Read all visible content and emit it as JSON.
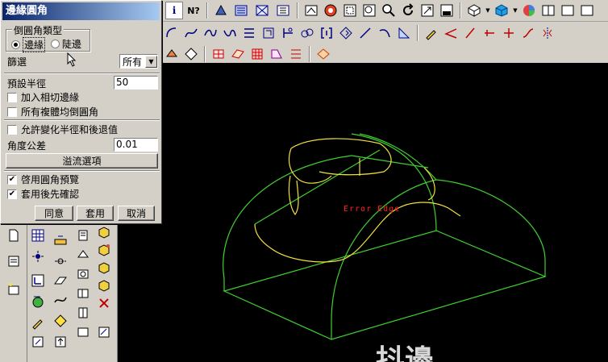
{
  "dialog": {
    "title": "邊緣圓角",
    "fillet_type_group": "倒圓角類型",
    "radio_edge": "邊緣",
    "radio_chain": "陡邊",
    "filter_label": "篩選",
    "filter_value": "所有",
    "default_radius_label": "預設半徑",
    "default_radius_value": "50",
    "add_tangent_edges": "加入相切邊緣",
    "fillet_all_solids": "所有複體均倒圓角",
    "allow_variable_radius": "允許變化半徑和後退值",
    "angle_tolerance_label": "角度公差",
    "angle_tolerance_value": "0.01",
    "overflow_options_button": "溢流選項",
    "enable_preview": "啓用圓角預覽",
    "confirm_after_apply": "套用後先確認",
    "ok_button": "同意",
    "apply_button": "套用",
    "cancel_button": "取消"
  },
  "state": {
    "radio_edge_selected": true,
    "add_tangent_edges_checked": false,
    "fillet_all_solids_checked": false,
    "allow_variable_radius_checked": false,
    "enable_preview_checked": true,
    "confirm_after_apply_checked": true
  },
  "toolbar": {
    "help_label": "i",
    "whats_this_label": "N?"
  },
  "viewport": {
    "error_label": "Error Edge",
    "watermark": "抖邊"
  },
  "colors": {
    "model_wire": "#40d030",
    "fillet_curve": "#f0e040",
    "error_text": "#ff2020"
  }
}
